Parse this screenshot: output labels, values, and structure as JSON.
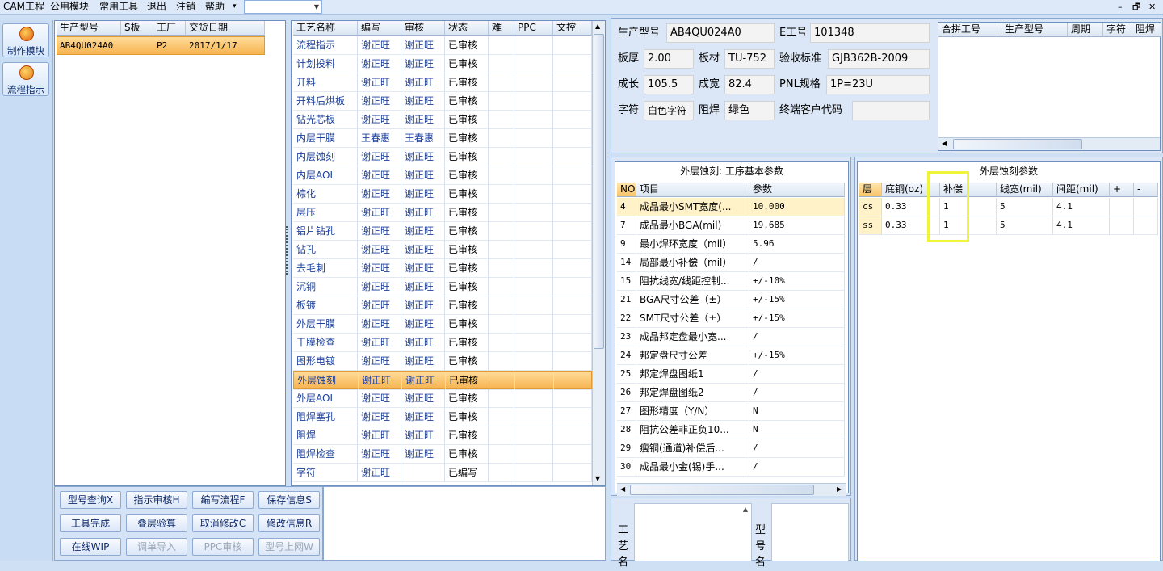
{
  "menu": [
    "CAM工程",
    "公用模块",
    "常用工具",
    "退出",
    "注销",
    "帮助",
    "▾"
  ],
  "window_controls": [
    "–",
    "🗗",
    "✕"
  ],
  "nav": [
    {
      "label": "制作模块",
      "icon": "fire-icon"
    },
    {
      "label": "流程指示",
      "icon": "flow-icon"
    }
  ],
  "model_table": {
    "headers": [
      "生产型号",
      "S板",
      "工厂",
      "交货日期"
    ],
    "rows": [
      [
        "AB4QU024A0",
        "",
        "P2",
        "2017/1/17"
      ]
    ]
  },
  "process_table": {
    "headers": [
      "工艺名称",
      "编写",
      "审核",
      "状态",
      "难",
      "PPC",
      "文控"
    ],
    "rows": [
      [
        "流程指示",
        "谢正旺",
        "谢正旺",
        "已审核"
      ],
      [
        "计划投料",
        "谢正旺",
        "谢正旺",
        "已审核"
      ],
      [
        "开料",
        "谢正旺",
        "谢正旺",
        "已审核"
      ],
      [
        "开料后烘板",
        "谢正旺",
        "谢正旺",
        "已审核"
      ],
      [
        "钻光芯板",
        "谢正旺",
        "谢正旺",
        "已审核"
      ],
      [
        "内层干膜",
        "王春惠",
        "王春惠",
        "已审核"
      ],
      [
        "内层蚀刻",
        "谢正旺",
        "谢正旺",
        "已审核"
      ],
      [
        "内层AOI",
        "谢正旺",
        "谢正旺",
        "已审核"
      ],
      [
        "棕化",
        "谢正旺",
        "谢正旺",
        "已审核"
      ],
      [
        "层压",
        "谢正旺",
        "谢正旺",
        "已审核"
      ],
      [
        "铝片钻孔",
        "谢正旺",
        "谢正旺",
        "已审核"
      ],
      [
        "钻孔",
        "谢正旺",
        "谢正旺",
        "已审核"
      ],
      [
        "去毛刺",
        "谢正旺",
        "谢正旺",
        "已审核"
      ],
      [
        "沉铜",
        "谢正旺",
        "谢正旺",
        "已审核"
      ],
      [
        "板镀",
        "谢正旺",
        "谢正旺",
        "已审核"
      ],
      [
        "外层干膜",
        "谢正旺",
        "谢正旺",
        "已审核"
      ],
      [
        "干膜检查",
        "谢正旺",
        "谢正旺",
        "已审核"
      ],
      [
        "图形电镀",
        "谢正旺",
        "谢正旺",
        "已审核"
      ],
      [
        "外层蚀刻",
        "谢正旺",
        "谢正旺",
        "已审核"
      ],
      [
        "外层AOI",
        "谢正旺",
        "谢正旺",
        "已审核"
      ],
      [
        "阻焊塞孔",
        "谢正旺",
        "谢正旺",
        "已审核"
      ],
      [
        "阻焊",
        "谢正旺",
        "谢正旺",
        "已审核"
      ],
      [
        "阻焊检查",
        "谢正旺",
        "谢正旺",
        "已审核"
      ],
      [
        "字符",
        "谢正旺",
        "",
        "已编写"
      ]
    ],
    "selected_index": 18
  },
  "buttons": [
    [
      "型号查询X",
      "指示审核H",
      "编写流程F",
      "保存信息S"
    ],
    [
      "工具完成",
      "叠层验算",
      "取消修改C",
      "修改信息R"
    ],
    [
      "在线WIP",
      "调单导入",
      "PPC审核",
      "型号上网W"
    ]
  ],
  "info": {
    "model_label": "生产型号",
    "model": "AB4QU024A0",
    "eno_label": "E工号",
    "eno": "101348",
    "thick_label": "板厚",
    "thick": "2.00",
    "mat_label": "板材",
    "mat": "TU-752",
    "std_label": "验收标准",
    "std": "GJB362B-2009",
    "len_label": "成长",
    "len": "105.5",
    "wid_label": "成宽",
    "wid": "82.4",
    "pnl_label": "PNL规格",
    "pnl": "1P=23U",
    "char_label": "字符",
    "char": "白色字符",
    "mask_label": "阻焊",
    "mask": "绿色",
    "cust_label": "终端客户代码",
    "cust": ""
  },
  "merge_table": {
    "headers": [
      "合拼工号",
      "生产型号",
      "周期",
      "字符",
      "阻焊"
    ]
  },
  "basic_params": {
    "title": "外层蚀刻: 工序基本参数",
    "headers": [
      "NO",
      "项目",
      "参数"
    ],
    "rows": [
      [
        "4",
        "成品最小SMT宽度(...",
        "10.000"
      ],
      [
        "7",
        "成品最小BGA(mil)",
        "19.685"
      ],
      [
        "9",
        "最小焊环宽度（mil）",
        "5.96"
      ],
      [
        "14",
        "局部最小补偿（mil）",
        "/"
      ],
      [
        "15",
        "阻抗线宽/线距控制...",
        "+/-10%"
      ],
      [
        "21",
        "BGA尺寸公差（±）",
        "+/-15%"
      ],
      [
        "22",
        "SMT尺寸公差（±）",
        "+/-15%"
      ],
      [
        "23",
        "成品邦定盘最小宽...",
        "/"
      ],
      [
        "24",
        "邦定盘尺寸公差",
        "+/-15%"
      ],
      [
        "25",
        "邦定焊盘图纸1",
        "/"
      ],
      [
        "26",
        "邦定焊盘图纸2",
        "/"
      ],
      [
        "27",
        "图形精度（Y/N）",
        "N"
      ],
      [
        "28",
        "阻抗公差非正负10...",
        "N"
      ],
      [
        "29",
        "瘦铜(通道)补偿后...",
        "/"
      ],
      [
        "30",
        "成品最小金(锡)手...",
        "/"
      ]
    ]
  },
  "etch_params": {
    "title": "外层蚀刻参数",
    "headers": [
      "层",
      "底铜(oz)",
      "补偿",
      "线宽(mil)",
      "间距(mil)",
      "+",
      "-"
    ],
    "rows": [
      [
        "cs",
        "0.33",
        "1",
        "5",
        "4.1"
      ],
      [
        "ss",
        "0.33",
        "1",
        "5",
        "4.1"
      ]
    ]
  },
  "bottom_labels": {
    "proc": "工艺名",
    "model": "型号名"
  }
}
